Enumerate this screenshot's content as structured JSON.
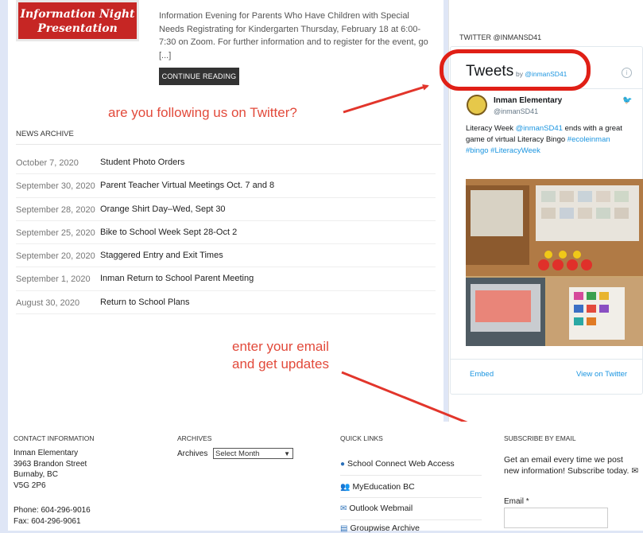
{
  "promo": {
    "image_text": "Information Night Presentation",
    "excerpt": "Information Evening for Parents Who Have Children with Special Needs Registrating for Kindergarten Thursday, February 18 at 6:00-7:30 on Zoom.  For further information and to register for the event, go [...]",
    "continue_label": "CONTINUE READING"
  },
  "news_archive": {
    "title": "NEWS ARCHIVE",
    "items": [
      {
        "date": "October 7, 2020",
        "title": "Student Photo Orders"
      },
      {
        "date": "September 30, 2020",
        "title": "Parent Teacher Virtual Meetings Oct. 7 and 8"
      },
      {
        "date": "September 28, 2020",
        "title": "Orange Shirt Day–Wed, Sept 30"
      },
      {
        "date": "September 25, 2020",
        "title": "Bike to School Week Sept 28-Oct 2"
      },
      {
        "date": "September 20, 2020",
        "title": "Staggered Entry and Exit Times"
      },
      {
        "date": "September 1, 2020",
        "title": "Inman Return to School Parent Meeting"
      },
      {
        "date": "August 30, 2020",
        "title": "Return to School Plans"
      }
    ]
  },
  "annotations": {
    "twitter": "are you following us on Twitter?",
    "email_line1": "enter your email",
    "email_line2": "and get updates",
    "color": "#e24a3b"
  },
  "twitter": {
    "section_title": "TWITTER @INMANSD41",
    "widget_title": "Tweets",
    "by_prefix": "by",
    "by_handle": "@inmanSD41",
    "tweet_author": "Inman Elementary",
    "tweet_handle": "@inmanSD41",
    "tweet_pre": "Literacy Week ",
    "tweet_mention": "@inmanSD41",
    "tweet_mid": " ends with a great game of virtual Literacy Bingo ",
    "tweet_tags": "#ecoleinman #bingo #LiteracyWeek",
    "embed_label": "Embed",
    "view_label": "View on Twitter"
  },
  "footer": {
    "contact": {
      "title": "CONTACT INFORMATION",
      "name": "Inman Elementary",
      "street": "3963 Brandon Street",
      "city": "Burnaby, BC",
      "postal": "V5G 2P6",
      "phone": "Phone: 604-296-9016",
      "fax": "Fax: 604-296-9061"
    },
    "archives": {
      "title": "ARCHIVES",
      "label": "Archives",
      "select_value": "Select Month"
    },
    "quick_links": {
      "title": "QUICK LINKS",
      "items": [
        "School Connect Web Access",
        "MyEducation BC",
        "Outlook Webmail",
        "Groupwise Archive"
      ]
    },
    "subscribe": {
      "title": "SUBSCRIBE BY EMAIL",
      "text": "Get an email every time we post new information! Subscribe today.",
      "email_label": "Email",
      "required_mark": "*"
    }
  }
}
